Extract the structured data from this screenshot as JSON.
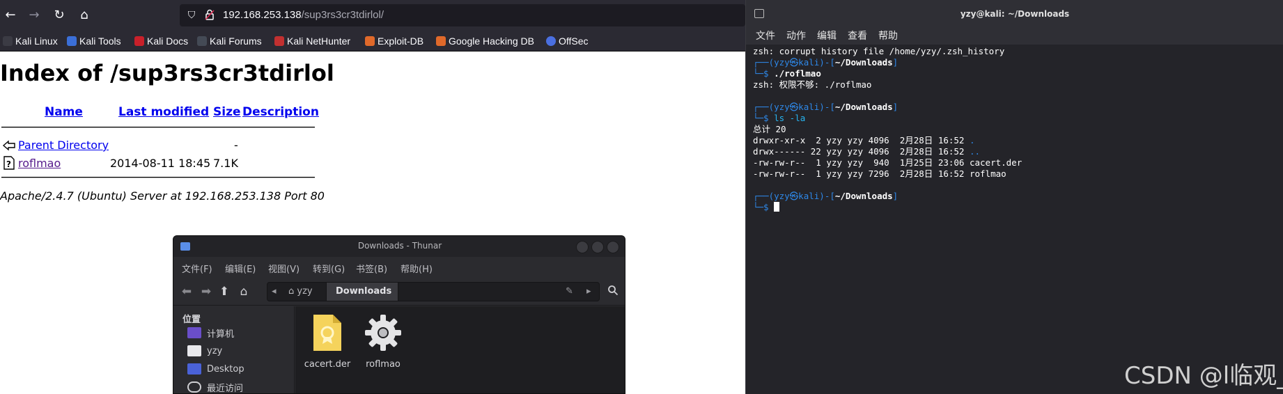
{
  "browser": {
    "url_host": "192.168.253.138",
    "url_path": "/sup3rs3cr3tdirlol/",
    "bookmarks": [
      "Kali Linux",
      "Kali Tools",
      "Kali Docs",
      "Kali Forums",
      "Kali NetHunter",
      "Exploit-DB",
      "Google Hacking DB",
      "OffSec"
    ],
    "page": {
      "title": "Index of /sup3rs3cr3tdirlol",
      "headers": {
        "name": "Name",
        "modified": "Last modified",
        "size": "Size",
        "description": "Description"
      },
      "rows": [
        {
          "name": "Parent Directory",
          "modified": "",
          "size": "-"
        },
        {
          "name": "roflmao",
          "modified": "2014-08-11 18:45",
          "size": "7.1K"
        }
      ],
      "address": "Apache/2.4.7 (Ubuntu) Server at 192.168.253.138 Port 80"
    }
  },
  "thunar": {
    "title": "Downloads - Thunar",
    "menu": [
      "文件(F)",
      "编辑(E)",
      "视图(V)",
      "转到(G)",
      "书签(B)",
      "帮助(H)"
    ],
    "path": {
      "home": "yzy",
      "current": "Downloads"
    },
    "sidebar_heading": "位置",
    "sidebar_items": [
      "计算机",
      "yzy",
      "Desktop",
      "最近访问"
    ],
    "files": [
      "cacert.der",
      "roflmao"
    ]
  },
  "terminal": {
    "title": "yzy@kali: ~/Downloads",
    "menu": [
      "文件",
      "动作",
      "编辑",
      "查看",
      "帮助"
    ],
    "prompt_user": "(yzy㉿kali)",
    "prompt_dir": "~/Downloads",
    "lines": {
      "history": "zsh: corrupt history file /home/yzy/.zsh_history",
      "cmd1": "./roflmao",
      "err1": "zsh: 权限不够: ./roflmao",
      "cmd2": "ls -la",
      "total": "总计 20",
      "ls1": "drwxr-xr-x  2 yzy yzy 4096  2月28日 16:52 ",
      "ls1_name": ".",
      "ls2": "drwx------ 22 yzy yzy 4096  2月28日 16:52 ",
      "ls2_name": "..",
      "ls3": "-rw-rw-r--  1 yzy yzy  940  1月25日 23:06 cacert.der",
      "ls4": "-rw-rw-r--  1 yzy yzy 7296  2月28日 16:52 roflmao"
    }
  },
  "watermark": "CSDN @l临观_"
}
